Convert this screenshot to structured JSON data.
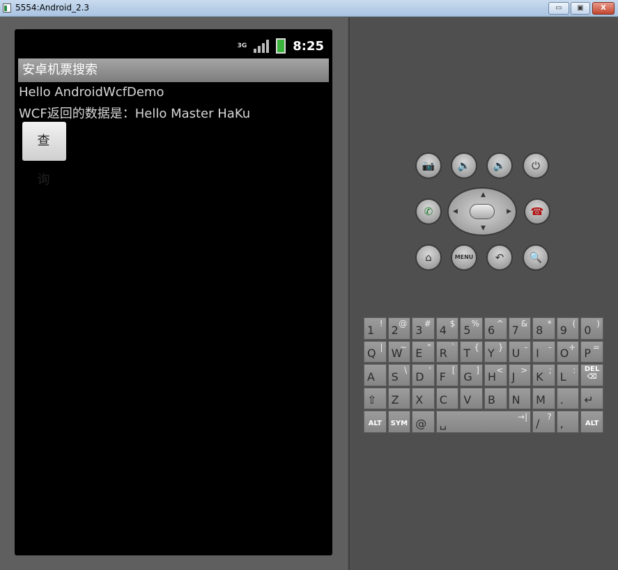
{
  "window": {
    "title": "5554:Android_2.3",
    "minimize": "▭",
    "restore": "▣",
    "close": "X"
  },
  "status": {
    "network": "3G",
    "time": "8:25"
  },
  "app": {
    "title": "安卓机票搜索",
    "line1": "Hello AndroidWcfDemo",
    "line2": "WCF返回的数据是：Hello Master HaKu",
    "button": "查 询"
  },
  "controls": {
    "menu": "MENU"
  },
  "keyboard": {
    "rows": [
      [
        {
          "m": "1",
          "a": "!"
        },
        {
          "m": "2",
          "a": "@"
        },
        {
          "m": "3",
          "a": "#"
        },
        {
          "m": "4",
          "a": "$"
        },
        {
          "m": "5",
          "a": "%"
        },
        {
          "m": "6",
          "a": "^"
        },
        {
          "m": "7",
          "a": "&"
        },
        {
          "m": "8",
          "a": "*"
        },
        {
          "m": "9",
          "a": "("
        },
        {
          "m": "0",
          "a": ")"
        }
      ],
      [
        {
          "m": "Q",
          "a": "|"
        },
        {
          "m": "W",
          "a": "~"
        },
        {
          "m": "E",
          "a": "\""
        },
        {
          "m": "R",
          "a": "`"
        },
        {
          "m": "T",
          "a": "{"
        },
        {
          "m": "Y",
          "a": "}"
        },
        {
          "m": "U",
          "a": "-"
        },
        {
          "m": "I",
          "a": "-"
        },
        {
          "m": "O",
          "a": "+"
        },
        {
          "m": "P",
          "a": "="
        }
      ],
      [
        {
          "m": "A",
          "a": ""
        },
        {
          "m": "S",
          "a": "\\"
        },
        {
          "m": "D",
          "a": "'"
        },
        {
          "m": "F",
          "a": "["
        },
        {
          "m": "G",
          "a": "]"
        },
        {
          "m": "H",
          "a": "<"
        },
        {
          "m": "J",
          "a": ">"
        },
        {
          "m": "K",
          "a": ";"
        },
        {
          "m": "L",
          "a": ":"
        },
        {
          "m": "",
          "a": "",
          "s": "DEL ⌫"
        }
      ],
      [
        {
          "m": "⇧",
          "a": ""
        },
        {
          "m": "Z",
          "a": ""
        },
        {
          "m": "X",
          "a": ""
        },
        {
          "m": "C",
          "a": ""
        },
        {
          "m": "V",
          "a": ""
        },
        {
          "m": "B",
          "a": ""
        },
        {
          "m": "N",
          "a": ""
        },
        {
          "m": "M",
          "a": ""
        },
        {
          "m": ".",
          "a": ""
        },
        {
          "m": "↵",
          "a": ""
        }
      ],
      [
        {
          "m": "",
          "a": "",
          "s": "ALT"
        },
        {
          "m": "",
          "a": "",
          "s": "SYM"
        },
        {
          "m": "@",
          "a": ""
        },
        {
          "m": "␣",
          "a": "→|",
          "space": true
        },
        {
          "m": "/",
          "a": "?"
        },
        {
          "m": ",",
          "a": ""
        },
        {
          "m": "",
          "a": "",
          "s": "ALT"
        }
      ]
    ]
  }
}
